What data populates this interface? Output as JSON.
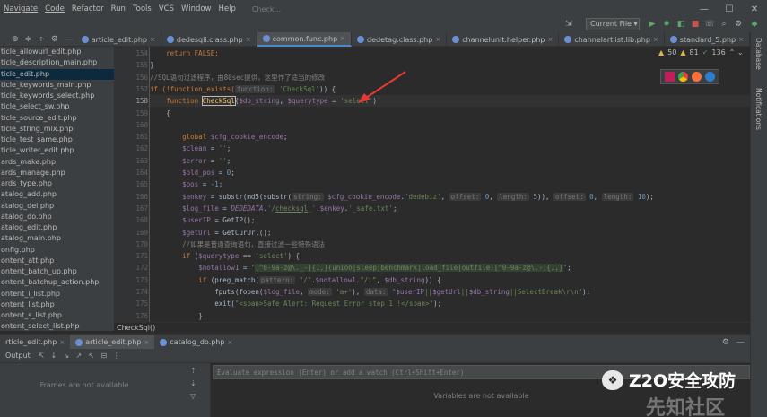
{
  "menu": {
    "items": [
      "Navigate",
      "Code",
      "Refactor",
      "Run",
      "Tools",
      "VCS",
      "Window",
      "Help"
    ],
    "underline_idx": [
      0,
      0,
      0,
      1,
      0,
      2,
      0,
      0
    ],
    "doc_title": "Check..."
  },
  "toolbar": {
    "run_config": "Current File",
    "run_config_arrow": "▾"
  },
  "editor_tabs": [
    {
      "label": "article_edit.php",
      "active": false
    },
    {
      "label": "dedesqli.class.php",
      "active": false
    },
    {
      "label": "common.func.php",
      "active": true
    },
    {
      "label": "dedetag.class.php",
      "active": false
    },
    {
      "label": "channelunit.helper.php",
      "active": false
    },
    {
      "label": "channelartlist.lib.php",
      "active": false
    },
    {
      "label": "standard_5.php",
      "active": false
    }
  ],
  "tab_close": "×",
  "project_head_icons": [
    "⊕",
    "≑",
    "÷",
    "⚙",
    "—"
  ],
  "project_files": [
    "ticle_allowurl_edit.php",
    "ticle_description_main.php",
    "ticle_edit.php",
    "ticle_keywords_main.php",
    "ticle_keywords_select.php",
    "ticle_select_sw.php",
    "ticle_source_edit.php",
    "ticle_string_mix.php",
    "ticle_test_same.php",
    "ticle_writer_edit.php",
    "ards_make.php",
    "ards_manage.php",
    "ards_type.php",
    "atalog_add.php",
    "atalog_del.php",
    "atalog_do.php",
    "atalog_edit.php",
    "atalog_main.php",
    "onfig.php",
    "ontent_att.php",
    "ontent_batch_up.php",
    "ontent_batchup_action.php",
    "ontent_i_list.php",
    "ontent_list.php",
    "ontent_s_list.php",
    "ontent_select_list.php"
  ],
  "selected_file_index": 2,
  "line_numbers": [
    154,
    155,
    156,
    157,
    158,
    159,
    160,
    161,
    162,
    163,
    164,
    165,
    166,
    167,
    168,
    169,
    170,
    171,
    172,
    173,
    174,
    175,
    176
  ],
  "current_line": 158,
  "code": {
    "l154": "return FALSE;",
    "l155": "}",
    "l156": "//SQL语句过滤程序，由80sec提供，这里作了适当的修改",
    "l157_a": "if (!function_exists(",
    "l157_hint": "function:",
    "l157_b": "'CheckSql'",
    "l157_c": ")) {",
    "l158_kw": "function ",
    "l158_fn": "CheckSql",
    "l158_a": "(",
    "l158_v1": "$db_string",
    "l158_b": ", ",
    "l158_v2": "$querytype",
    "l158_c": " = ",
    "l158_s": "'select'",
    "l158_d": ")",
    "l159": "{",
    "l161_kw": "global ",
    "l161_v": "$cfg_cookie_encode",
    "l161_e": ";",
    "l162_v": "$clean",
    "l162_a": " = ",
    "l162_s": "''",
    "l162_e": ";",
    "l163_v": "$error",
    "l163_a": " = ",
    "l163_s": "''",
    "l163_e": ";",
    "l164_v": "$old_pos",
    "l164_a": " = ",
    "l164_n": "0",
    "l164_e": ";",
    "l165_v": "$pos",
    "l165_a": " = ",
    "l165_n": "-1",
    "l165_e": ";",
    "l166_v": "$enkey",
    "l166_a": " = substr(md5(substr(",
    "l166_h1": "string:",
    "l166_v2": "$cfg_cookie_encode",
    "l166_b": ".",
    "l166_s": "'dedebiz'",
    "l166_c": ", ",
    "l166_h2": "offset:",
    "l166_n1": "0",
    "l166_d": ", ",
    "l166_h3": "length:",
    "l166_n2": "5",
    "l166_f": ")), ",
    "l166_h4": "offset:",
    "l166_n3": "0",
    "l166_g": ", ",
    "l166_h5": "length:",
    "l166_n4": "10",
    "l166_e": ");",
    "l167_v": "$log_file",
    "l167_a": " = ",
    "l167_c": "DEDEDATA",
    "l167_b": ".",
    "l167_s1": "'/",
    "l167_s2": "checksql",
    "l167_s3": "_'",
    "l167_d": ".",
    "l167_v2": "$enkey",
    "l167_f": ".",
    "l167_s4": "'_safe.txt'",
    "l167_e": ";",
    "l168_v": "$userIP",
    "l168_a": " = GetIP();",
    "l169_v": "$getUrl",
    "l169_a": " = GetCurUrl();",
    "l170": "//如果是普通查询语句，直接过滤一些特殊语法",
    "l171_kw": "if ",
    "l171_a": "(",
    "l171_v": "$querytype",
    "l171_b": " == ",
    "l171_s": "'select'",
    "l171_c": ") {",
    "l172_v": "$notallow1",
    "l172_a": " = ",
    "l172_q1": "\"",
    "l172_r": "[^0-9a-z@\\._-]{1,}(union|sleep|benchmark|load_file|outfile)[^0-9a-z@\\.-]{1,}",
    "l172_q2": "\"",
    "l172_e": ";",
    "l173_kw": "if ",
    "l173_a": "(preg_match(",
    "l173_h": "pattern:",
    "l173_s1": "\"/\"",
    "l173_b": ".",
    "l173_v": "$notallow1",
    "l173_c": ".",
    "l173_s2": "\"/i\"",
    "l173_d": ", ",
    "l173_v2": "$db_string",
    "l173_e": ")) {",
    "l174_a": "fputs(fopen(",
    "l174_v": "$log_file",
    "l174_b": ", ",
    "l174_h1": "mode:",
    "l174_s1": "'a+'",
    "l174_c": "), ",
    "l174_h2": "data:",
    "l174_s2": "\"",
    "l174_v2": "$userIP",
    "l174_s3": "||",
    "l174_v3": "$getUrl",
    "l174_s4": "||",
    "l174_v4": "$db_string",
    "l174_s5": "||SelectBreak\\r\\n\"",
    "l174_e": ");",
    "l175_a": "exit(",
    "l175_s": "\"<span>Safe Alert: Request Error step 1 !</span>\"",
    "l175_e": ");",
    "l176": "}",
    "l177": "}"
  },
  "inspection": {
    "warnings": "50",
    "weak": "81",
    "typos": "136",
    "warn_icon": "▲",
    "weak_icon": "▲",
    "typo_icon": "✓",
    "nav": "⌃ ⌄"
  },
  "right_strip": {
    "database": "Database",
    "notifications": "Notifications"
  },
  "breadcrumb": "CheckSql()",
  "bottom_tabs": [
    {
      "label": "rticle_edit.php",
      "active": false
    },
    {
      "label": "article_edit.php",
      "active": true
    },
    {
      "label": "catalog_do.php",
      "active": false
    }
  ],
  "bottom_right_icons": [
    "⚙",
    "—"
  ],
  "debug": {
    "output_label": "Output",
    "icons": [
      "⇱",
      "↓",
      "↘",
      "↗",
      "↖",
      "⊟",
      "⋮"
    ],
    "frames_msg": "Frames are not available",
    "frames_tools": [
      "⇡",
      "⇣",
      "▽"
    ],
    "eval_placeholder": "Evaluate expression (Enter) or add a watch (Ctrl+Shift+Enter)",
    "vars_msg": "Variables are not available"
  },
  "watermark": {
    "logo": "❖",
    "brand": "Z2O安全攻防",
    "sub": "先知社区"
  },
  "colors": {
    "accent": "#4a88c7",
    "bg": "#2b2b2b",
    "panel": "#3c3f41",
    "keyword": "#cc7832",
    "string": "#6a8759",
    "variable": "#9876aa",
    "arrow": "#e53935"
  }
}
